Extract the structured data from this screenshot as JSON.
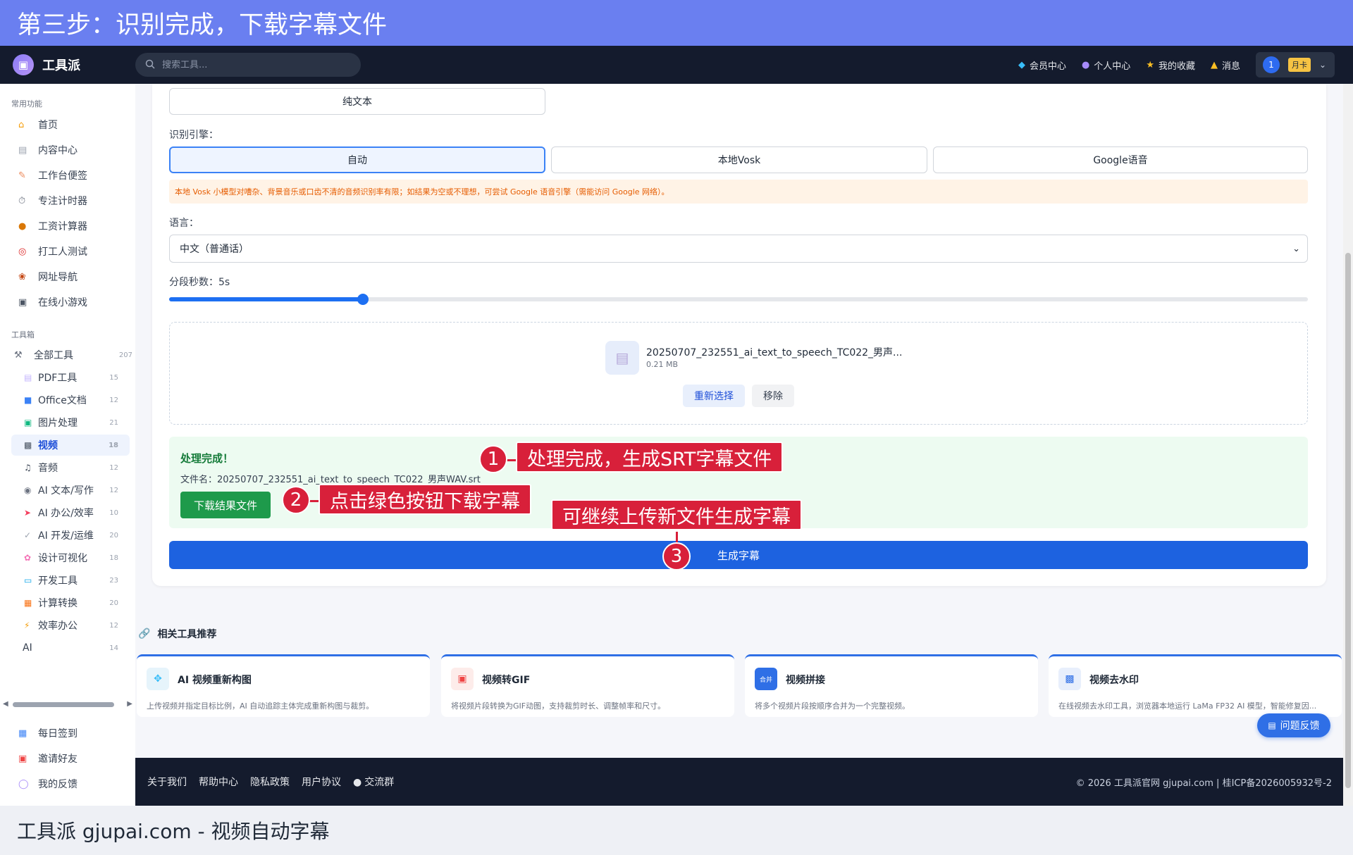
{
  "banner": {
    "title": "第三步：识别完成，下载字幕文件"
  },
  "caption": {
    "text": "工具派 gjupai.com - 视频自动字幕"
  },
  "navbar": {
    "logo_text": "工具派",
    "search_placeholder": "搜索工具...",
    "links": [
      "会员中心",
      "个人中心",
      "我的收藏",
      "消息"
    ],
    "user_number": "1",
    "user_badge": "月卡"
  },
  "sidebar": {
    "section_common": "常用功能",
    "common_items": [
      "首页",
      "内容中心",
      "工作台便签",
      "专注计时器",
      "工资计算器",
      "打工人测试",
      "网址导航",
      "在线小游戏"
    ],
    "section_tools": "工具箱",
    "all_tools": {
      "label": "全部工具",
      "count": "207"
    },
    "categories": [
      {
        "label": "PDF工具",
        "count": "15"
      },
      {
        "label": "Office文档",
        "count": "12"
      },
      {
        "label": "图片处理",
        "count": "21"
      },
      {
        "label": "视频",
        "count": "18"
      },
      {
        "label": "音频",
        "count": "12"
      },
      {
        "label": "AI 文本/写作",
        "count": "12"
      },
      {
        "label": "AI 办公/效率",
        "count": "10"
      },
      {
        "label": "AI 开发/运维",
        "count": "20"
      },
      {
        "label": "设计可视化",
        "count": "18"
      },
      {
        "label": "开发工具",
        "count": "23"
      },
      {
        "label": "计算转换",
        "count": "20"
      },
      {
        "label": "效率办公",
        "count": "12"
      },
      {
        "label": "AI",
        "count": "14"
      }
    ],
    "bottom_items": [
      "每日签到",
      "邀请好友",
      "我的反馈"
    ]
  },
  "main": {
    "output_format_selected": "纯文本",
    "engine_label": "识别引擎：",
    "engines": [
      "自动",
      "本地Vosk",
      "Google语音"
    ],
    "warning": "本地 Vosk 小模型对嘈杂、背景音乐或口齿不清的音频识别率有限；如结果为空或不理想，可尝试 Google 语音引擎（需能访问 Google 网络）。",
    "language_label": "语言：",
    "language_value": "中文（普通话）",
    "segment_label": "分段秒数：5s",
    "segment_fraction": 0.17,
    "file_name": "20250707_232551_ai_text_to_speech_TC022_男声...",
    "file_size": "0.21 MB",
    "reselect_label": "重新选择",
    "remove_label": "移除",
    "result_title": "处理完成！",
    "result_file": "文件名：20250707_232551_ai_text_to_speech_TC022_男声WAV.srt",
    "download_label": "下载结果文件",
    "generate_label": "生成字幕"
  },
  "annotations": [
    {
      "num": "1",
      "text": "处理完成，生成SRT字幕文件"
    },
    {
      "num": "2",
      "text": "点击绿色按钮下载字幕"
    },
    {
      "num": "3",
      "text": "可继续上传新文件生成字幕"
    }
  ],
  "related": {
    "title": "相关工具推荐",
    "tools": [
      {
        "name": "AI 视频重新构图",
        "desc": "上传视频并指定目标比例，AI 自动追踪主体完成重新构图与裁剪。"
      },
      {
        "name": "视频转GIF",
        "desc": "将视频片段转换为GIF动图，支持裁剪时长、调整帧率和尺寸。"
      },
      {
        "name": "视频拼接",
        "desc": "将多个视频片段按顺序合并为一个完整视频。",
        "icon_text": "合并"
      },
      {
        "name": "视频去水印",
        "desc": "在线视频去水印工具，浏览器本地运行 LaMa FP32 AI 模型，智能修复因..."
      }
    ]
  },
  "feedback_label": "问题反馈",
  "footer": {
    "links": [
      "关于我们",
      "帮助中心",
      "隐私政策",
      "用户协议",
      "交流群"
    ],
    "copyright": "© 2026 工具派官网 gjupai.com | 桂ICP备2026005932号-2"
  },
  "colors": {
    "accent": "#1d62e0",
    "success": "#1e9a4b",
    "annotation": "#d8203a",
    "banner": "#6a7ff0"
  }
}
